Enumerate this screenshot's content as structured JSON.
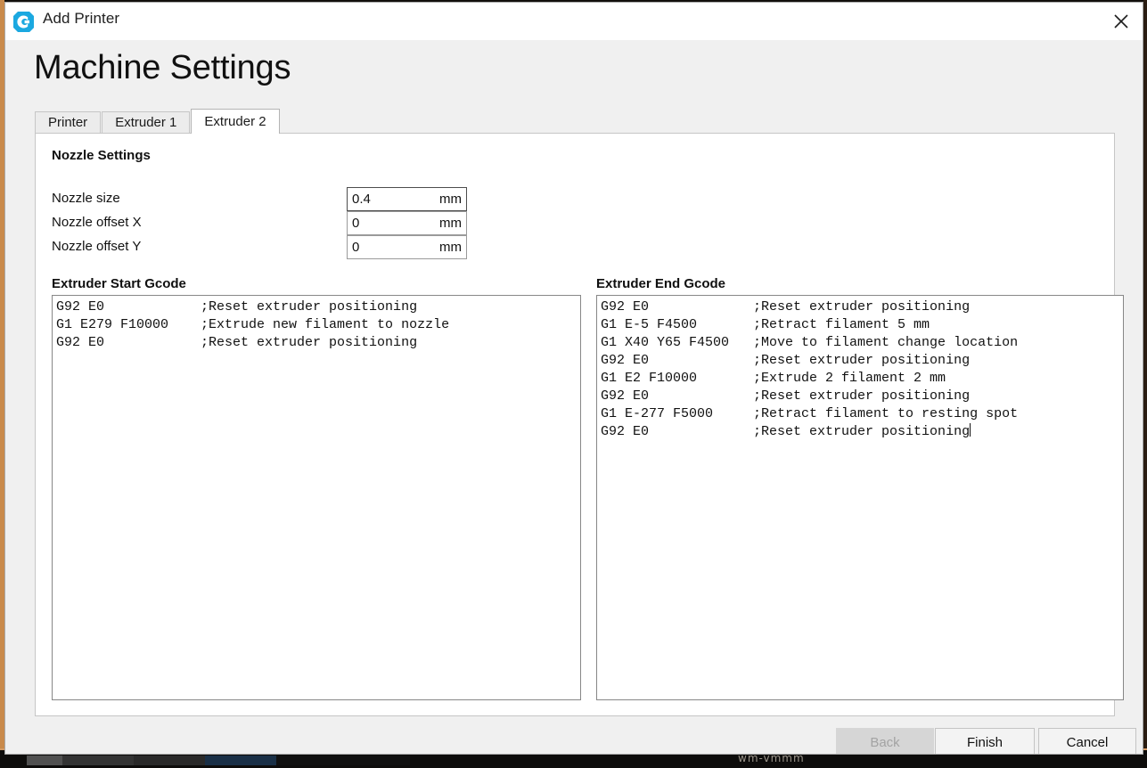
{
  "window": {
    "title": "Add Printer",
    "logo_icon": "cura-logo-icon",
    "close_icon": "close-icon"
  },
  "page": {
    "heading": "Machine Settings"
  },
  "tabs": [
    {
      "label": "Printer",
      "active": false
    },
    {
      "label": "Extruder 1",
      "active": false
    },
    {
      "label": "Extruder 2",
      "active": true
    }
  ],
  "nozzle_settings": {
    "heading": "Nozzle Settings",
    "fields": [
      {
        "label": "Nozzle size",
        "value": "0.4",
        "unit": "mm",
        "focused": true
      },
      {
        "label": "Nozzle offset X",
        "value": "0",
        "unit": "mm",
        "focused": false
      },
      {
        "label": "Nozzle offset Y",
        "value": "0",
        "unit": "mm",
        "focused": false
      }
    ]
  },
  "start_gcode": {
    "heading": "Extruder Start Gcode",
    "value": "G92 E0            ;Reset extruder positioning\nG1 E279 F10000    ;Extrude new filament to nozzle\nG92 E0            ;Reset extruder positioning"
  },
  "end_gcode": {
    "heading": "Extruder End Gcode",
    "value": "G92 E0             ;Reset extruder positioning\nG1 E-5 F4500       ;Retract filament 5 mm\nG1 X40 Y65 F4500   ;Move to filament change location\nG92 E0             ;Reset extruder positioning\nG1 E2 F10000       ;Extrude 2 filament 2 mm\nG92 E0             ;Reset extruder positioning\nG1 E-277 F5000     ;Retract filament to resting spot\nG92 E0             ;Reset extruder positioning"
  },
  "footer": {
    "back_label": "Back",
    "finish_label": "Finish",
    "cancel_label": "Cancel",
    "back_disabled": true
  },
  "backdrop": {
    "taskbar_text": "wm-vmmm"
  },
  "colors": {
    "accent": "#1ba8e0",
    "window_bg": "#f0f0f0",
    "panel_bg": "#ffffff",
    "border": "#c6c6c6",
    "text": "#111111",
    "disabled_text": "#a3a3a3"
  }
}
